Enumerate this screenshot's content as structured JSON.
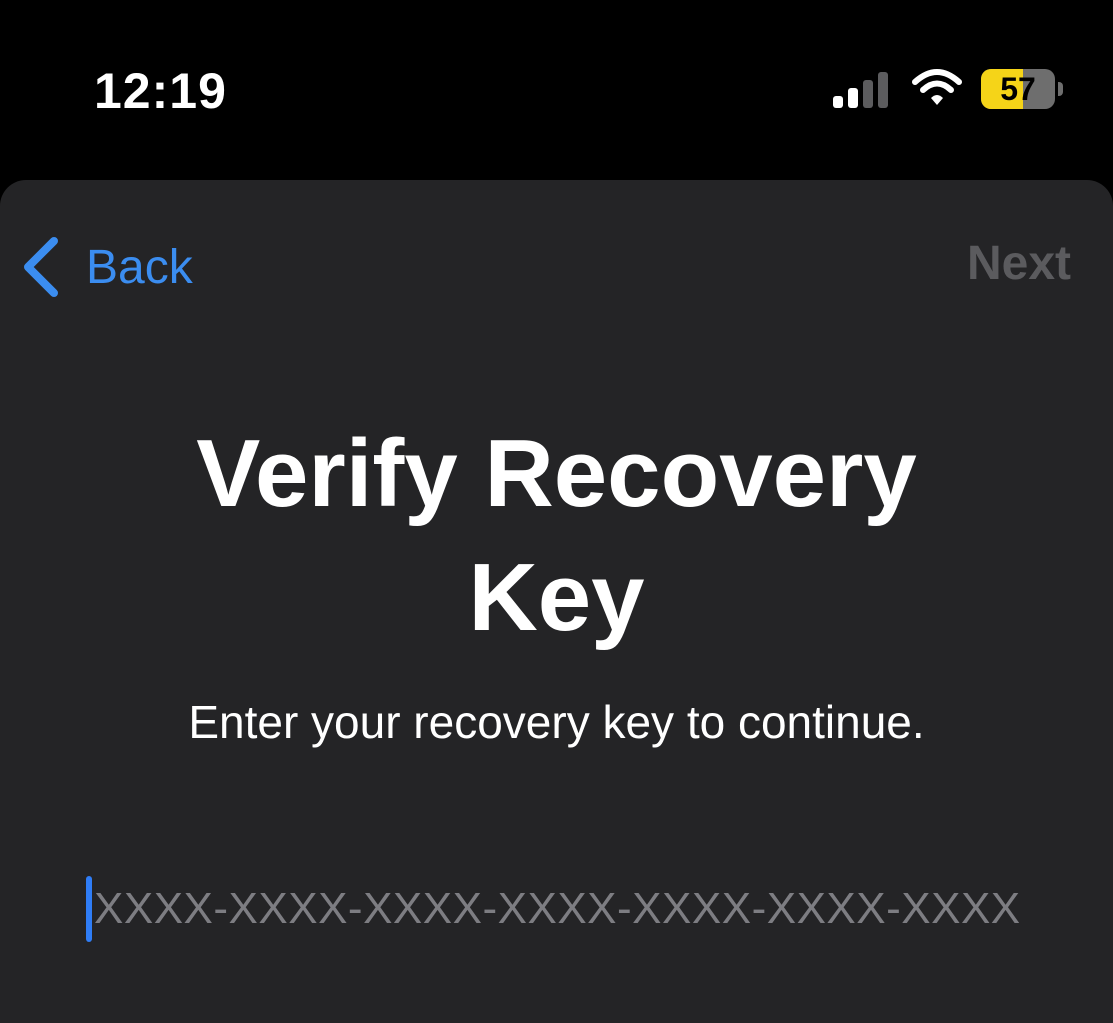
{
  "status_bar": {
    "time": "12:19",
    "battery_level": "57",
    "battery_fraction": 0.57,
    "icons": [
      "signal-icon",
      "wifi-icon",
      "battery-icon"
    ]
  },
  "nav": {
    "back_label": "Back",
    "next_label": "Next"
  },
  "main": {
    "title_line1": "Verify Recovery",
    "title_line2": "Key",
    "subtitle": "Enter your recovery key to continue.",
    "key_placeholder": "XXXX-XXXX-XXXX-XXXX-XXXX-XXXX-XXXX"
  },
  "colors": {
    "accent": "#3b8df0",
    "battery_fill": "#f5d418",
    "sheet_background": "#242426",
    "disabled_text": "#5b5b5e"
  }
}
